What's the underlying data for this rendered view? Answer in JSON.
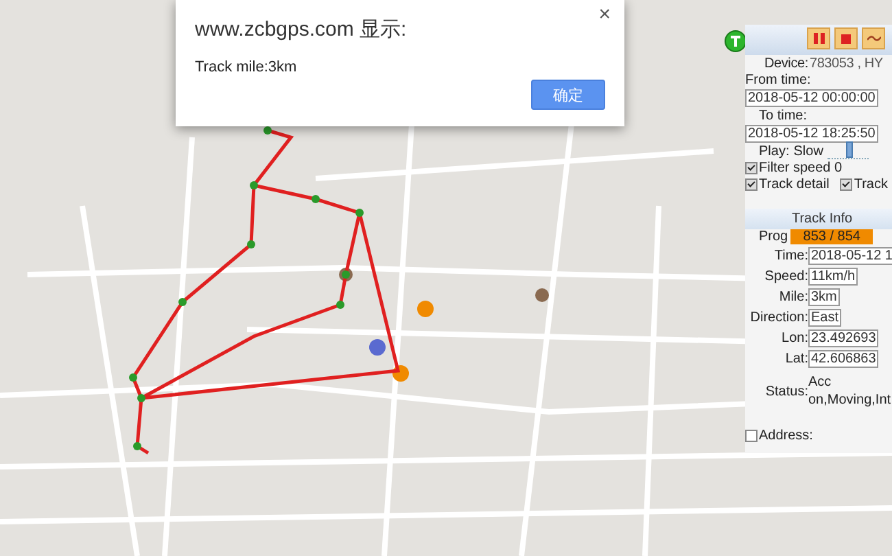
{
  "dialog": {
    "title": "www.zcbgps.com 显示:",
    "message": "Track mile:3km",
    "close": "×",
    "button": "确定"
  },
  "panel": {
    "controls": [
      {
        "kind": "pause"
      },
      {
        "kind": "stop"
      },
      {
        "kind": "route"
      }
    ],
    "device": {
      "label": "Device:",
      "value": "783053 , HY"
    },
    "from": {
      "label": "From time:",
      "value": "2018-05-12 00:00:00"
    },
    "to": {
      "label": "To time:",
      "value": "2018-05-12 18:25:50"
    },
    "play": {
      "label": "Play:",
      "speed": "Slow",
      "level": 0.55
    },
    "option_rows": [
      [
        {
          "label": "Filter speed 0",
          "checked": true
        }
      ],
      [
        {
          "label": "Track detail",
          "checked": true
        },
        {
          "label": "Track",
          "checked": true
        }
      ]
    ],
    "track_info": {
      "title": "Track Info",
      "progress": {
        "label": "Prog",
        "reading": "853 / 854",
        "level": 0.999
      },
      "fields": [
        {
          "label": "Time:",
          "value": "2018-05-12 1"
        },
        {
          "label": "Speed:",
          "value": "11km/h"
        },
        {
          "label": "Mile:",
          "value": "3km"
        },
        {
          "label": "Direction:",
          "value": "East"
        },
        {
          "label": "Lon:",
          "value": "23.492693"
        },
        {
          "label": "Lat:",
          "value": "42.606863"
        }
      ],
      "status": {
        "label": "Status:",
        "value": "Acc on,Moving,Int"
      },
      "address": {
        "label": "Address:",
        "checked": false
      }
    }
  }
}
